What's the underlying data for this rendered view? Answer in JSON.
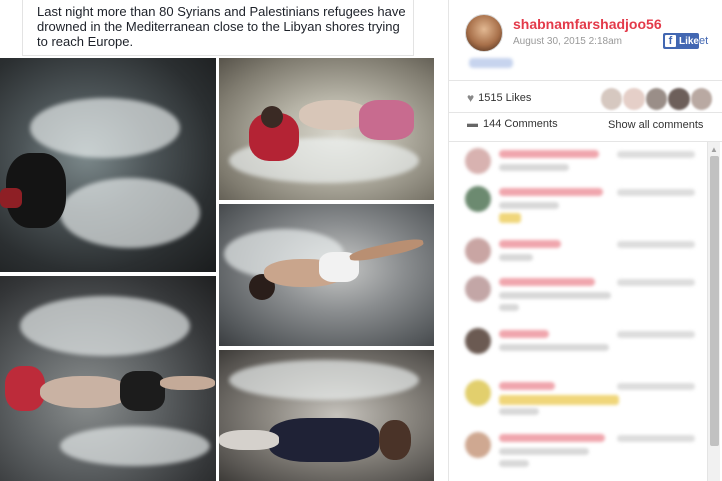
{
  "post": {
    "caption": "Last night more than 80 Syrians and Palestinians refugees have drowned in the Mediterranean close to the Libyan shores trying to reach Europe."
  },
  "profile": {
    "username": "shabnamfarshadjoo56",
    "date": "August 30, 2015 2:18am"
  },
  "like_button": {
    "icon": "f",
    "label": "Like",
    "overflow": "et"
  },
  "stats": {
    "likes": "1515 Likes",
    "comments": "144 Comments",
    "show_all": "Show all comments"
  },
  "icons": {
    "heart": "heart-icon",
    "comment": "comment-icon",
    "facebook": "facebook-icon",
    "scroll_up": "chevron-up-icon"
  },
  "colors": {
    "username": "#e33a4a",
    "facebook_blue": "#4267b2"
  }
}
